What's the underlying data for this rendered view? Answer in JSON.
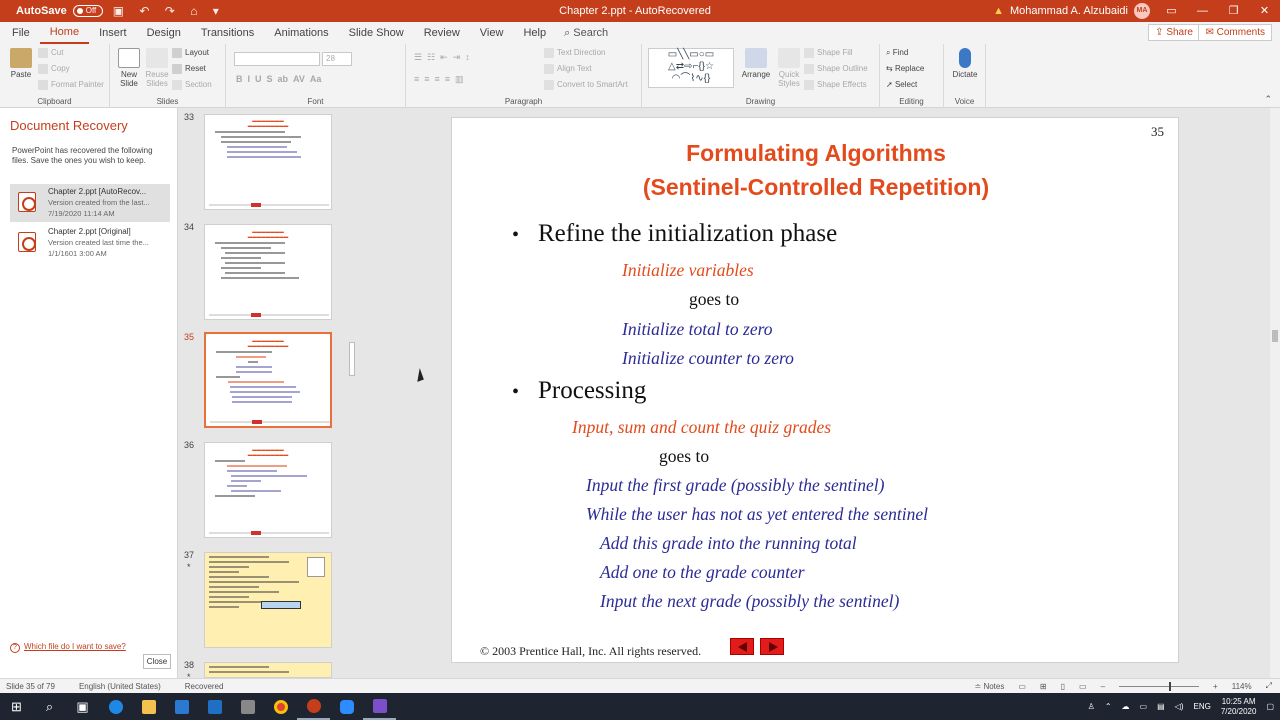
{
  "titlebar": {
    "autosave_label": "AutoSave",
    "autosave_state": "Off",
    "doc_title": "Chapter 2.ppt  -  AutoRecovered",
    "user_name": "Mohammad A. Alzubaidi",
    "user_initials": "MA"
  },
  "menu": {
    "tabs": [
      "File",
      "Home",
      "Insert",
      "Design",
      "Transitions",
      "Animations",
      "Slide Show",
      "Review",
      "View",
      "Help"
    ],
    "active_tab": "Home",
    "search_label": "Search",
    "share_label": "Share",
    "comments_label": "Comments"
  },
  "ribbon": {
    "clipboard": {
      "label": "Clipboard",
      "paste": "Paste",
      "cut": "Cut",
      "copy": "Copy",
      "format_painter": "Format Painter"
    },
    "slides": {
      "label": "Slides",
      "new_slide": "New Slide",
      "reuse_slides": "Reuse Slides",
      "layout": "Layout",
      "reset": "Reset",
      "section": "Section"
    },
    "font": {
      "label": "Font",
      "size": "28"
    },
    "paragraph": {
      "label": "Paragraph",
      "text_direction": "Text Direction",
      "align_text": "Align Text",
      "convert_smartart": "Convert to SmartArt"
    },
    "drawing": {
      "label": "Drawing",
      "arrange": "Arrange",
      "quick_styles": "Quick Styles",
      "shape_fill": "Shape Fill",
      "shape_outline": "Shape Outline",
      "shape_effects": "Shape Effects"
    },
    "editing": {
      "label": "Editing",
      "find": "Find",
      "replace": "Replace",
      "select": "Select"
    },
    "voice": {
      "label": "Voice",
      "dictate": "Dictate"
    }
  },
  "recovery": {
    "title": "Document Recovery",
    "description": "PowerPoint has recovered the following files.  Save the ones you wish to keep.",
    "files": [
      {
        "name": "Chapter 2.ppt  [AutoRecov...",
        "sub": "Version created from the last...",
        "date": "7/19/2020 11:14 AM"
      },
      {
        "name": "Chapter 2.ppt  [Original]",
        "sub": "Version created last time the...",
        "date": "1/1/1601 3:00 AM"
      }
    ],
    "help_link": "Which file do I want to save?",
    "close_label": "Close"
  },
  "thumbnails": [
    {
      "num": "33"
    },
    {
      "num": "34"
    },
    {
      "num": "35"
    },
    {
      "num": "36"
    },
    {
      "num": "37",
      "star": "*"
    },
    {
      "num": "38",
      "star": "*"
    }
  ],
  "slide": {
    "number": "35",
    "title_line1": "Formulating Algorithms",
    "title_line2": "(Sentinel-Controlled Repetition)",
    "bullet1": "Refine the initialization phase",
    "b1_red": "Initialize variables",
    "b1_goes": "goes to",
    "b1_blue1": "Initialize total to zero",
    "b1_blue2": "Initialize counter to zero",
    "bullet2": "Processing",
    "b2_red": "Input, sum and count the quiz grades",
    "b2_goes": "goes to",
    "b2_blue1": "Input the first grade (possibly the sentinel)",
    "b2_blue2": "While the user has not as yet entered the sentinel",
    "b2_blue3": "Add this grade into the running total",
    "b2_blue4": "Add one to the grade counter",
    "b2_blue5": "Input the next grade (possibly the sentinel)",
    "copyright": "© 2003 Prentice Hall, Inc.  All rights reserved."
  },
  "status": {
    "slide_info": "Slide 35 of 79",
    "language": "English (United States)",
    "recovered": "Recovered",
    "notes": "Notes",
    "zoom": "114%"
  },
  "taskbar": {
    "lang": "ENG",
    "time": "10:25 AM",
    "date": "7/20/2020"
  }
}
